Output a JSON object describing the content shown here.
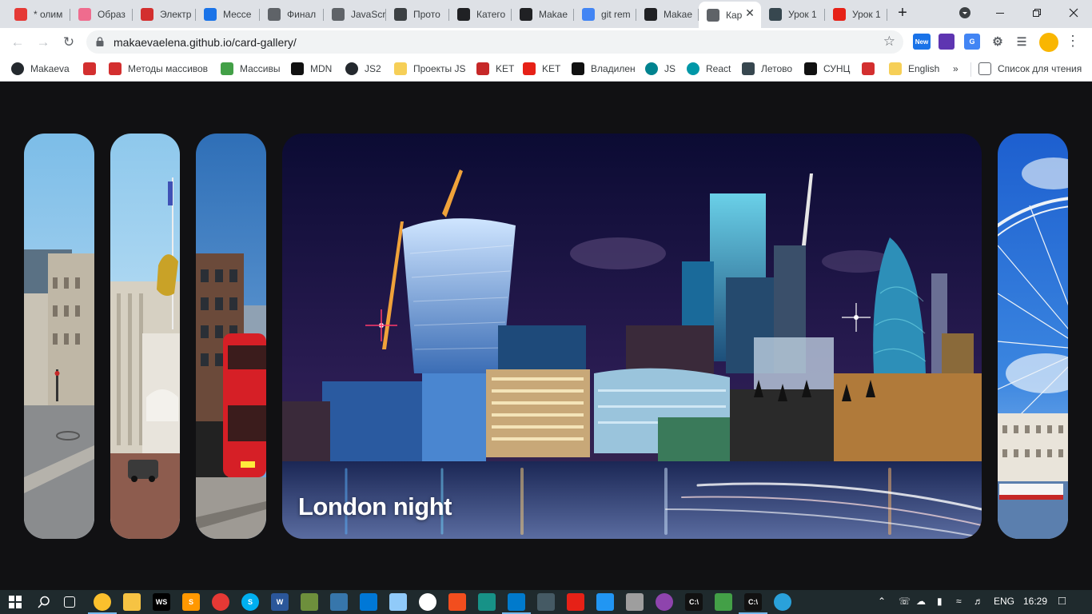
{
  "browser": {
    "tabs": [
      {
        "title": "* олим",
        "color": "#e53935"
      },
      {
        "title": "Образ",
        "color": "#ef6c8e"
      },
      {
        "title": "Электр",
        "color": "#d32f2f"
      },
      {
        "title": "Мессе",
        "color": "#1a73e8"
      },
      {
        "title": "Финал",
        "color": "#5f6368"
      },
      {
        "title": "JavaScr",
        "color": "#5f6368"
      },
      {
        "title": "Прото",
        "color": "#3c4043"
      },
      {
        "title": "Катего",
        "color": "#202124"
      },
      {
        "title": "Makae",
        "color": "#202124"
      },
      {
        "title": "git rem",
        "color": "#4285f4"
      },
      {
        "title": "Makae",
        "color": "#202124"
      },
      {
        "title": "Кар",
        "color": "#5f6368",
        "active": true
      },
      {
        "title": "Урок 1",
        "color": "#37474f"
      },
      {
        "title": "Урок 1",
        "color": "#e62117"
      }
    ],
    "new_tab": "+",
    "url": "makaevaelena.github.io/card-gallery/",
    "extension_badge": "New",
    "bookmarks": [
      {
        "label": "Makaeva",
        "icon": "github-icon",
        "color": "#24292e"
      },
      {
        "label": "",
        "icon": "figure-icon",
        "color": "#d32f2f"
      },
      {
        "label": "Методы массивов",
        "icon": "figure-icon",
        "color": "#d32f2f"
      },
      {
        "label": "Массивы",
        "icon": "leaf-icon",
        "color": "#43a047"
      },
      {
        "label": "MDN",
        "icon": "mdn-icon",
        "color": "#111111"
      },
      {
        "label": "JS2",
        "icon": "github-icon",
        "color": "#24292e"
      },
      {
        "label": "Проекты JS",
        "icon": "folder-icon",
        "color": "#f6cf57"
      },
      {
        "label": "KET",
        "icon": "flag-uk-icon",
        "color": "#c62828"
      },
      {
        "label": "KET",
        "icon": "youtube-icon",
        "color": "#e62117"
      },
      {
        "label": "Владилен",
        "icon": "notion-icon",
        "color": "#111111"
      },
      {
        "label": "JS",
        "icon": "globe-icon",
        "color": "#00838f"
      },
      {
        "label": "React",
        "icon": "react-icon",
        "color": "#0097a7"
      },
      {
        "label": "Летово",
        "icon": "shield-icon",
        "color": "#37474f"
      },
      {
        "label": "СУНЦ",
        "icon": "n-icon",
        "color": "#111111"
      },
      {
        "label": "",
        "icon": "gto-icon",
        "color": "#d32f2f"
      },
      {
        "label": "English",
        "icon": "folder-icon",
        "color": "#f6cf57"
      }
    ],
    "more_bookmarks": "»",
    "reading_list": "Список для чтения"
  },
  "gallery": {
    "cards": [
      {
        "id": "street",
        "caption": "",
        "expanded": false
      },
      {
        "id": "monument",
        "caption": "",
        "expanded": false
      },
      {
        "id": "bus",
        "caption": "",
        "expanded": false
      },
      {
        "id": "night",
        "caption": "London night",
        "expanded": true
      },
      {
        "id": "eye",
        "caption": "",
        "expanded": false
      }
    ]
  },
  "taskbar": {
    "apps": [
      {
        "name": "task-view",
        "label": "",
        "color": "#1f2a2d"
      },
      {
        "name": "chrome",
        "label": "",
        "color": "#fbc02d",
        "running": true
      },
      {
        "name": "explorer",
        "label": "",
        "color": "#f6c343"
      },
      {
        "name": "webstorm",
        "label": "WS",
        "color": "#000000"
      },
      {
        "name": "sublime",
        "label": "S",
        "color": "#ff9800"
      },
      {
        "name": "recorder",
        "label": "",
        "color": "#e53935"
      },
      {
        "name": "skype",
        "label": "S",
        "color": "#00aff0"
      },
      {
        "name": "word",
        "label": "W",
        "color": "#2b579a"
      },
      {
        "name": "minecraft",
        "label": "",
        "color": "#6d8f3c"
      },
      {
        "name": "python",
        "label": "",
        "color": "#3776ab"
      },
      {
        "name": "paint",
        "label": "",
        "color": "#0078d7"
      },
      {
        "name": "notepad",
        "label": "",
        "color": "#90caf9"
      },
      {
        "name": "photos",
        "label": "",
        "color": "#ffffff"
      },
      {
        "name": "figma",
        "label": "",
        "color": "#f24e1e"
      },
      {
        "name": "gitkraken",
        "label": "",
        "color": "#179287"
      },
      {
        "name": "vscode",
        "label": "",
        "color": "#007acc",
        "running": true
      },
      {
        "name": "calculator",
        "label": "",
        "color": "#455a64"
      },
      {
        "name": "youtube",
        "label": "",
        "color": "#e62117"
      },
      {
        "name": "monitor",
        "label": "",
        "color": "#2196f3"
      },
      {
        "name": "vr",
        "label": "",
        "color": "#9e9e9e"
      },
      {
        "name": "github-desktop",
        "label": "",
        "color": "#8e44ad"
      },
      {
        "name": "cmd",
        "label": "C:\\",
        "color": "#111111"
      },
      {
        "name": "node",
        "label": "",
        "color": "#43a047"
      },
      {
        "name": "cmd2",
        "label": "C:\\",
        "color": "#111111",
        "running": true
      },
      {
        "name": "telegram",
        "label": "",
        "color": "#2aa1da"
      }
    ],
    "language": "ENG",
    "time": "16:29"
  }
}
